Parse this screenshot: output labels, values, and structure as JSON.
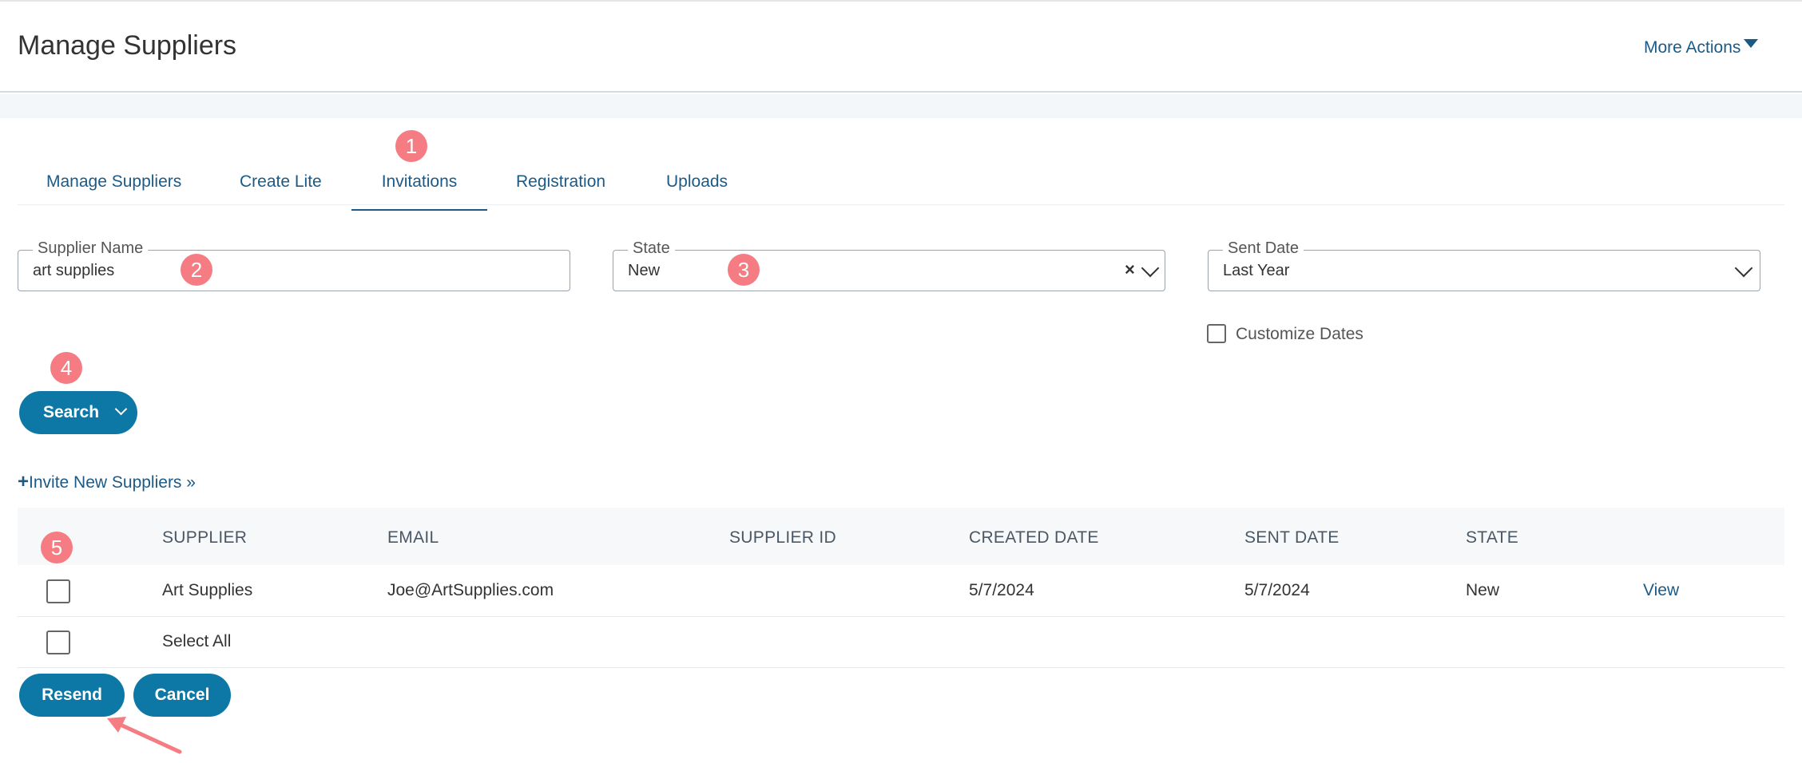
{
  "header": {
    "title": "Manage Suppliers",
    "more_actions": "More Actions"
  },
  "tabs": [
    {
      "label": "Manage Suppliers",
      "active": false
    },
    {
      "label": "Create Lite",
      "active": false
    },
    {
      "label": "Invitations",
      "active": true
    },
    {
      "label": "Registration",
      "active": false
    },
    {
      "label": "Uploads",
      "active": false
    }
  ],
  "filters": {
    "supplier_name": {
      "label": "Supplier Name",
      "value": "art supplies"
    },
    "state": {
      "label": "State",
      "value": "New"
    },
    "sent_date": {
      "label": "Sent Date",
      "value": "Last Year"
    },
    "customize_dates": {
      "label": "Customize Dates",
      "checked": false
    }
  },
  "search_button": {
    "label": "Search"
  },
  "invite_link": {
    "plus": "+",
    "label": "Invite New Suppliers »"
  },
  "table": {
    "headers": [
      "SUPPLIER",
      "EMAIL",
      "SUPPLIER ID",
      "CREATED DATE",
      "SENT DATE",
      "STATE"
    ],
    "rows": [
      {
        "supplier": "Art Supplies",
        "email": "Joe@ArtSupplies.com",
        "supplier_id": "",
        "created_date": "5/7/2024",
        "sent_date": "5/7/2024",
        "state": "New",
        "action": "View",
        "checked": false
      }
    ],
    "select_all": "Select All"
  },
  "actions": {
    "resend": "Resend",
    "cancel": "Cancel"
  },
  "annotations": {
    "badges": [
      "1",
      "2",
      "3",
      "4",
      "5"
    ],
    "badge_color": "#f47c82"
  },
  "colors": {
    "accent": "#0d78a6",
    "link": "#1b5a86"
  }
}
